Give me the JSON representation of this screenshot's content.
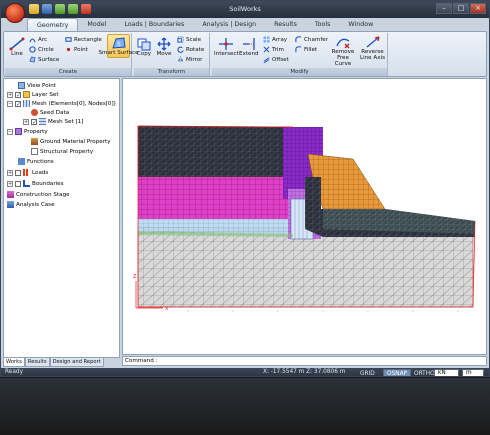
{
  "window": {
    "title": "SoilWorks",
    "controls": [
      "–",
      "□",
      "×"
    ]
  },
  "qat": {
    "items": [
      "open-folder-icon",
      "save-icon",
      "undo-icon",
      "redo-icon",
      "stop-icon"
    ]
  },
  "menu_tabs": [
    "Geometry",
    "Model",
    "Loads | Boundaries",
    "Analysis | Design",
    "Results",
    "Tools",
    "Window"
  ],
  "ribbon": {
    "create": {
      "label": "Create",
      "line": "Line",
      "arc": "Arc",
      "circle": "Circle",
      "surface": "Surface",
      "rectangle": "Rectangle",
      "point": "Point",
      "smart_surface": "Smart Surface"
    },
    "transform": {
      "label": "Transform",
      "copy": "Copy",
      "move": "Move",
      "scale": "Scale",
      "rotate": "Rotate",
      "mirror": "Mirror"
    },
    "modify": {
      "label": "Modify",
      "intersect": "Intersect",
      "extend": "Extend",
      "array": "Array",
      "trim": "Trim",
      "offset": "Offset",
      "chamfer": "Chamfer",
      "fillet": "Fillet",
      "remove_free_curve": "Remove Free Curve",
      "reverse_line_axis": "Reverse Line Axis"
    }
  },
  "tree": {
    "view_point": "View Point",
    "layer_set": "Layer Set",
    "mesh": "Mesh (Elements[0], Nodes[0])",
    "seed_data": "Seed Data",
    "mesh_set": "Mesh Set [1]",
    "property": "Property",
    "ground_material": "Ground Material Property",
    "structural": "Structural Property",
    "functions": "Functions",
    "loads": "Loads",
    "boundaries": "Boundaries",
    "construction_stage": "Construction Stage",
    "analysis_case": "Analysis Case"
  },
  "bottom_tabs": [
    "Works",
    "Results",
    "Design and Report"
  ],
  "command": {
    "label": "Command :"
  },
  "status": {
    "ready": "Ready",
    "coords": "X: -17.5547 m  Z: 37.0806 m",
    "grid": "GRID",
    "osnap": "OSNAP",
    "ortho": "ORTHO",
    "force_unit": "kN",
    "length_unit": "m"
  },
  "colors": {
    "mesh_dark": "#2b2f3a",
    "mesh_gray": "#cfcfcf",
    "magenta": "#e040c8",
    "orange": "#e89a3a",
    "purple": "#8a2bc8",
    "teal": "#3a4a4e",
    "light_blue": "#b8d8f0",
    "axis_red": "#e02020"
  }
}
